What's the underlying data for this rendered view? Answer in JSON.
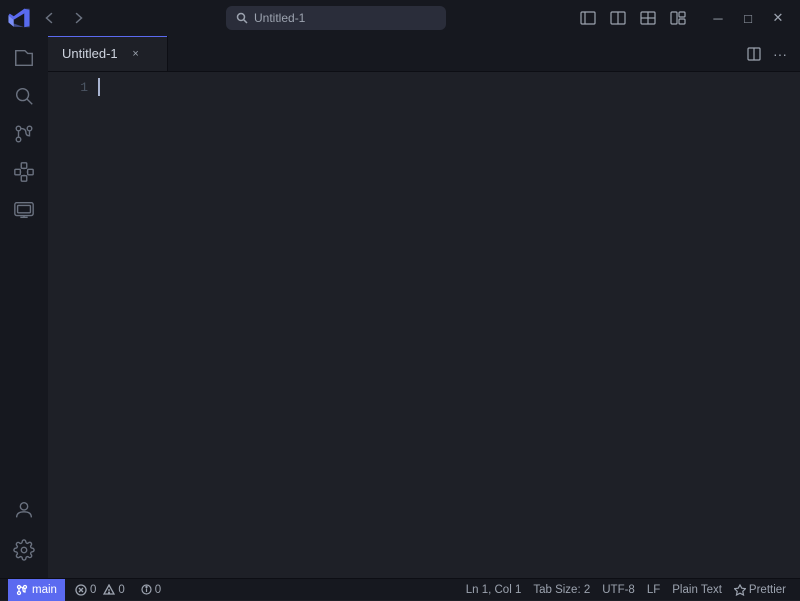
{
  "titlebar": {
    "logo_label": "VSCodium",
    "nav": {
      "back_label": "←",
      "forward_label": "→"
    },
    "search": {
      "text": "Untitled-1"
    },
    "actions": {
      "split_label": "⊟",
      "layout1_label": "⊞",
      "layout2_label": "⊟",
      "layout3_label": "⊠",
      "minimize_label": "─",
      "maximize_label": "□",
      "close_label": "✕"
    }
  },
  "tabs": [
    {
      "label": "Untitled-1",
      "close": "×"
    }
  ],
  "tab_actions": {
    "split_label": "⫠",
    "more_label": "…"
  },
  "editor": {
    "line_numbers": [
      "1"
    ],
    "content": ""
  },
  "activity": {
    "items": [
      {
        "name": "explorer-icon",
        "symbol": "📄",
        "active": false
      },
      {
        "name": "search-icon",
        "symbol": "🔍",
        "active": false
      },
      {
        "name": "source-control-icon",
        "symbol": "⑂",
        "active": false
      },
      {
        "name": "extensions-icon",
        "symbol": "⊞",
        "active": false
      },
      {
        "name": "remote-icon",
        "symbol": "⊡",
        "active": false
      }
    ],
    "bottom": [
      {
        "name": "account-icon",
        "symbol": "👤"
      },
      {
        "name": "settings-icon",
        "symbol": "⚙"
      }
    ]
  },
  "statusbar": {
    "branch": "main",
    "errors": "0",
    "warnings": "0",
    "info": "0",
    "position": "Ln 1, Col 1",
    "tab_size": "Tab Size: 2",
    "encoding": "UTF-8",
    "eol": "LF",
    "language": "Plain Text",
    "formatter": "Prettier"
  },
  "colors": {
    "accent": "#5b6af0",
    "bg_dark": "#16181f",
    "bg_main": "#1e2027",
    "tab_border_top": "#5b6af0"
  }
}
